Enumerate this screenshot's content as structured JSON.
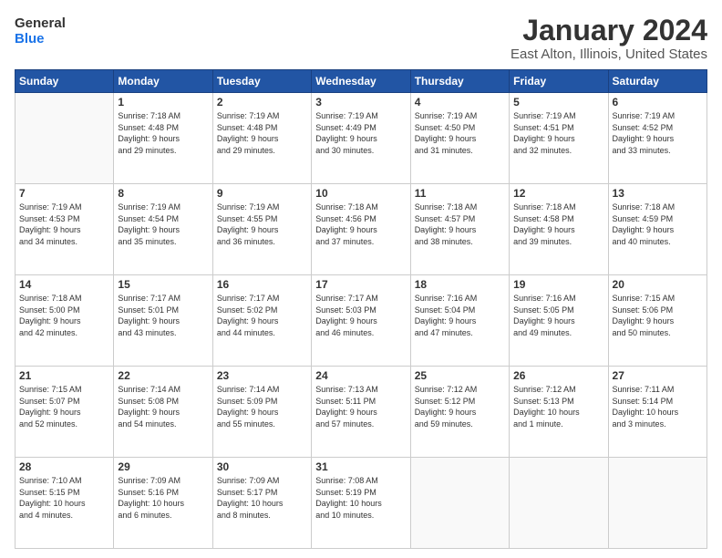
{
  "header": {
    "logo_general": "General",
    "logo_blue": "Blue",
    "month_title": "January 2024",
    "location": "East Alton, Illinois, United States"
  },
  "days_of_week": [
    "Sunday",
    "Monday",
    "Tuesday",
    "Wednesday",
    "Thursday",
    "Friday",
    "Saturday"
  ],
  "weeks": [
    [
      {
        "day": "",
        "info": ""
      },
      {
        "day": "1",
        "info": "Sunrise: 7:18 AM\nSunset: 4:48 PM\nDaylight: 9 hours\nand 29 minutes."
      },
      {
        "day": "2",
        "info": "Sunrise: 7:19 AM\nSunset: 4:48 PM\nDaylight: 9 hours\nand 29 minutes."
      },
      {
        "day": "3",
        "info": "Sunrise: 7:19 AM\nSunset: 4:49 PM\nDaylight: 9 hours\nand 30 minutes."
      },
      {
        "day": "4",
        "info": "Sunrise: 7:19 AM\nSunset: 4:50 PM\nDaylight: 9 hours\nand 31 minutes."
      },
      {
        "day": "5",
        "info": "Sunrise: 7:19 AM\nSunset: 4:51 PM\nDaylight: 9 hours\nand 32 minutes."
      },
      {
        "day": "6",
        "info": "Sunrise: 7:19 AM\nSunset: 4:52 PM\nDaylight: 9 hours\nand 33 minutes."
      }
    ],
    [
      {
        "day": "7",
        "info": "Sunrise: 7:19 AM\nSunset: 4:53 PM\nDaylight: 9 hours\nand 34 minutes."
      },
      {
        "day": "8",
        "info": "Sunrise: 7:19 AM\nSunset: 4:54 PM\nDaylight: 9 hours\nand 35 minutes."
      },
      {
        "day": "9",
        "info": "Sunrise: 7:19 AM\nSunset: 4:55 PM\nDaylight: 9 hours\nand 36 minutes."
      },
      {
        "day": "10",
        "info": "Sunrise: 7:18 AM\nSunset: 4:56 PM\nDaylight: 9 hours\nand 37 minutes."
      },
      {
        "day": "11",
        "info": "Sunrise: 7:18 AM\nSunset: 4:57 PM\nDaylight: 9 hours\nand 38 minutes."
      },
      {
        "day": "12",
        "info": "Sunrise: 7:18 AM\nSunset: 4:58 PM\nDaylight: 9 hours\nand 39 minutes."
      },
      {
        "day": "13",
        "info": "Sunrise: 7:18 AM\nSunset: 4:59 PM\nDaylight: 9 hours\nand 40 minutes."
      }
    ],
    [
      {
        "day": "14",
        "info": "Sunrise: 7:18 AM\nSunset: 5:00 PM\nDaylight: 9 hours\nand 42 minutes."
      },
      {
        "day": "15",
        "info": "Sunrise: 7:17 AM\nSunset: 5:01 PM\nDaylight: 9 hours\nand 43 minutes."
      },
      {
        "day": "16",
        "info": "Sunrise: 7:17 AM\nSunset: 5:02 PM\nDaylight: 9 hours\nand 44 minutes."
      },
      {
        "day": "17",
        "info": "Sunrise: 7:17 AM\nSunset: 5:03 PM\nDaylight: 9 hours\nand 46 minutes."
      },
      {
        "day": "18",
        "info": "Sunrise: 7:16 AM\nSunset: 5:04 PM\nDaylight: 9 hours\nand 47 minutes."
      },
      {
        "day": "19",
        "info": "Sunrise: 7:16 AM\nSunset: 5:05 PM\nDaylight: 9 hours\nand 49 minutes."
      },
      {
        "day": "20",
        "info": "Sunrise: 7:15 AM\nSunset: 5:06 PM\nDaylight: 9 hours\nand 50 minutes."
      }
    ],
    [
      {
        "day": "21",
        "info": "Sunrise: 7:15 AM\nSunset: 5:07 PM\nDaylight: 9 hours\nand 52 minutes."
      },
      {
        "day": "22",
        "info": "Sunrise: 7:14 AM\nSunset: 5:08 PM\nDaylight: 9 hours\nand 54 minutes."
      },
      {
        "day": "23",
        "info": "Sunrise: 7:14 AM\nSunset: 5:09 PM\nDaylight: 9 hours\nand 55 minutes."
      },
      {
        "day": "24",
        "info": "Sunrise: 7:13 AM\nSunset: 5:11 PM\nDaylight: 9 hours\nand 57 minutes."
      },
      {
        "day": "25",
        "info": "Sunrise: 7:12 AM\nSunset: 5:12 PM\nDaylight: 9 hours\nand 59 minutes."
      },
      {
        "day": "26",
        "info": "Sunrise: 7:12 AM\nSunset: 5:13 PM\nDaylight: 10 hours\nand 1 minute."
      },
      {
        "day": "27",
        "info": "Sunrise: 7:11 AM\nSunset: 5:14 PM\nDaylight: 10 hours\nand 3 minutes."
      }
    ],
    [
      {
        "day": "28",
        "info": "Sunrise: 7:10 AM\nSunset: 5:15 PM\nDaylight: 10 hours\nand 4 minutes."
      },
      {
        "day": "29",
        "info": "Sunrise: 7:09 AM\nSunset: 5:16 PM\nDaylight: 10 hours\nand 6 minutes."
      },
      {
        "day": "30",
        "info": "Sunrise: 7:09 AM\nSunset: 5:17 PM\nDaylight: 10 hours\nand 8 minutes."
      },
      {
        "day": "31",
        "info": "Sunrise: 7:08 AM\nSunset: 5:19 PM\nDaylight: 10 hours\nand 10 minutes."
      },
      {
        "day": "",
        "info": ""
      },
      {
        "day": "",
        "info": ""
      },
      {
        "day": "",
        "info": ""
      }
    ]
  ]
}
